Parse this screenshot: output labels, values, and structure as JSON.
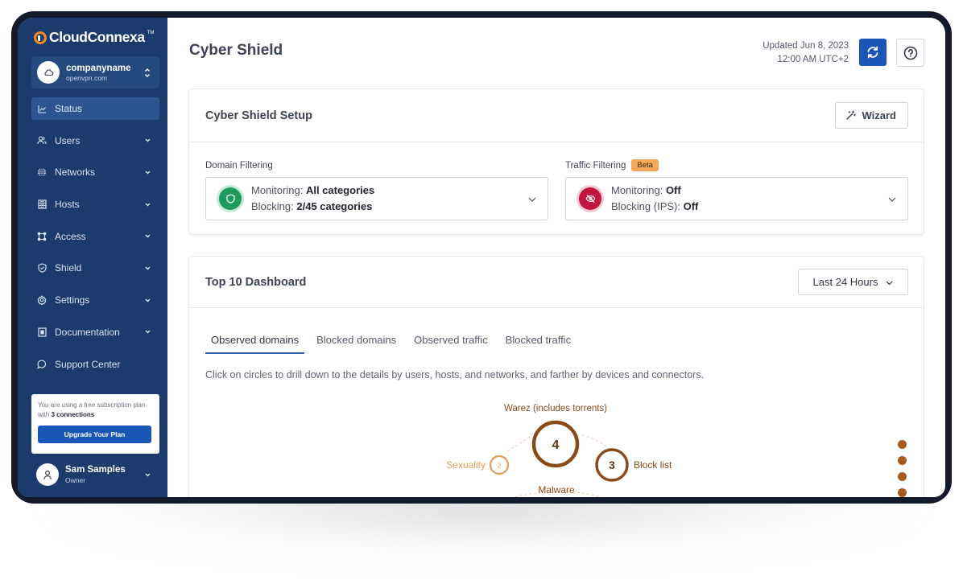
{
  "app": {
    "logo_text": "CloudConnexa",
    "logo_tm": "TM"
  },
  "org": {
    "name": "companyname",
    "domain": "openvpn.com"
  },
  "sidebar": {
    "items": [
      {
        "label": "Status",
        "icon": "chart-line-icon",
        "active": true,
        "expandable": false
      },
      {
        "label": "Users",
        "icon": "users-icon",
        "active": false,
        "expandable": true
      },
      {
        "label": "Networks",
        "icon": "globe-icon",
        "active": false,
        "expandable": true
      },
      {
        "label": "Hosts",
        "icon": "server-icon",
        "active": false,
        "expandable": true
      },
      {
        "label": "Access",
        "icon": "access-nodes-icon",
        "active": false,
        "expandable": true
      },
      {
        "label": "Shield",
        "icon": "shield-check-icon",
        "active": false,
        "expandable": true
      },
      {
        "label": "Settings",
        "icon": "gear-icon",
        "active": false,
        "expandable": true
      },
      {
        "label": "Documentation",
        "icon": "document-icon",
        "active": false,
        "expandable": true
      },
      {
        "label": "Support Center",
        "icon": "chat-bubble-icon",
        "active": false,
        "expandable": false
      }
    ],
    "plan": {
      "text_prefix": "You are using a free subscription plan with ",
      "connections": "3 connections",
      "upgrade_label": "Upgrade Your Plan"
    },
    "user": {
      "name": "Sam Samples",
      "role": "Owner"
    }
  },
  "header": {
    "title": "Cyber Shield",
    "updated_line1": "Updated Jun 8, 2023",
    "updated_line2": "12:00 AM UTC+2"
  },
  "setup": {
    "title": "Cyber Shield Setup",
    "wizard_label": "Wizard",
    "domain_filtering": {
      "label": "Domain Filtering",
      "monitoring_label": "Monitoring:",
      "monitoring_value": "All categories",
      "blocking_label": "Blocking:",
      "blocking_value": "2/45 categories",
      "status_color": "#1f9a5e"
    },
    "traffic_filtering": {
      "label": "Traffic Filtering",
      "badge": "Beta",
      "monitoring_label": "Monitoring:",
      "monitoring_value": "Off",
      "blocking_label": "Blocking (IPS):",
      "blocking_value": "Off",
      "status_color": "#c1173f"
    }
  },
  "dashboard": {
    "title": "Top 10 Dashboard",
    "range": "Last 24 Hours",
    "tabs": [
      {
        "label": "Observed domains",
        "active": true
      },
      {
        "label": "Blocked domains",
        "active": false
      },
      {
        "label": "Observed traffic",
        "active": false
      },
      {
        "label": "Blocked traffic",
        "active": false
      }
    ],
    "hint": "Click on circles to drill down to the details by users, hosts, and networks, and farther by devices and connectors.",
    "bubbles": [
      {
        "label": "Warez (includes torrents)",
        "count": "4",
        "color": "#8a4a17"
      },
      {
        "label": "Block list",
        "count": "3",
        "color": "#8a4a17"
      },
      {
        "label": "Sexuality",
        "count": "2",
        "color": "#e59a55"
      },
      {
        "label": "Malware",
        "count": "",
        "color": "#8a4a17"
      }
    ]
  }
}
